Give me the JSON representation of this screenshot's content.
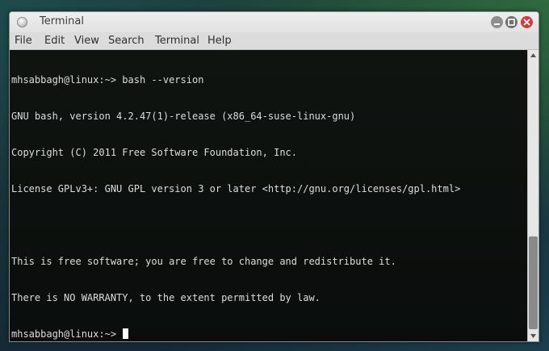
{
  "window": {
    "title": "Terminal"
  },
  "menu": [
    "File",
    "Edit",
    "View",
    "Search",
    "Terminal",
    "Help"
  ],
  "terminal": {
    "lines": [
      "mhsabbagh@linux:~> bash --version",
      "GNU bash, version 4.2.47(1)-release (x86_64-suse-linux-gnu)",
      "Copyright (C) 2011 Free Software Foundation, Inc.",
      "License GPLv3+: GNU GPL version 3 or later <http://gnu.org/licenses/gpl.html>",
      "",
      "This is free software; you are free to change and redistribute it.",
      "There is NO WARRANTY, to the extent permitted by law."
    ],
    "prompt": "mhsabbagh@linux:~> "
  },
  "scroll": {
    "position_fraction": 1.0,
    "visible_fraction": 0.35
  },
  "icons": {
    "app": "terminal-app-icon",
    "minimize": "minimize-icon",
    "maximize": "maximize-icon",
    "close": "close-icon",
    "scroll_up": "arrow-up-icon",
    "scroll_down": "arrow-down-icon"
  },
  "colors": {
    "close_button": "#d63a3a",
    "terminal_bg": "#0d110e",
    "terminal_fg": "#dcdcdc"
  }
}
